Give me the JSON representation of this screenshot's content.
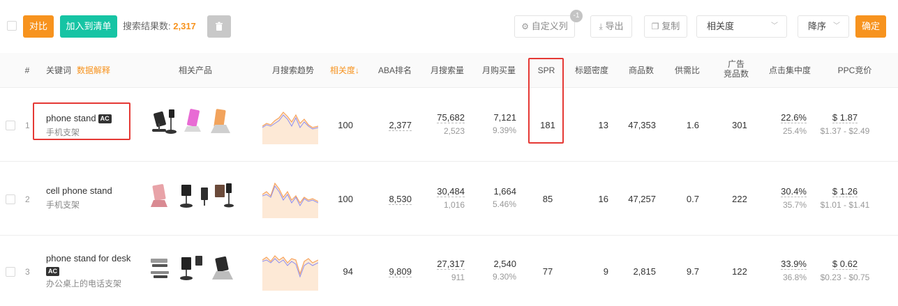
{
  "toolbar": {
    "compare_label": "对比",
    "add_to_list_label": "加入到清单",
    "result_label": "搜索结果数:",
    "result_count": "2,317",
    "customize_label": "自定义列",
    "customize_badge": "-1",
    "export_label": "导出",
    "copy_label": "复制",
    "sort_field": "相关度",
    "sort_order": "降序",
    "confirm_label": "确定"
  },
  "columns": {
    "index": "#",
    "keyword": "关键词",
    "keyword_help": "数据解释",
    "products": "相关产品",
    "trend": "月搜索趋势",
    "relevance": "相关度",
    "aba_rank": "ABA排名",
    "monthly_search": "月搜索量",
    "monthly_purchase": "月购买量",
    "spr": "SPR",
    "title_density": "标题密度",
    "product_count": "商品数",
    "supply_demand": "供需比",
    "ad_products_line1": "广告",
    "ad_products_line2": "竞品数",
    "click_concentration": "点击集中度",
    "ppc_bid": "PPC竞价"
  },
  "rows": [
    {
      "index": "1",
      "keyword": "phone stand",
      "ac": "AC",
      "keyword_cn": "手机支架",
      "relevance": "100",
      "aba_rank": "2,377",
      "monthly_search": "75,682",
      "monthly_search_sub": "2,523",
      "monthly_purchase": "7,121",
      "purchase_rate": "9.39%",
      "spr": "181",
      "title_density": "13",
      "product_count": "47,353",
      "supply_demand": "1.6",
      "ad_products": "301",
      "click_conc": "22.6%",
      "click_conc_sub": "25.4%",
      "ppc": "$ 1.87",
      "ppc_range": "$1.37 - $2.49"
    },
    {
      "index": "2",
      "keyword": "cell phone stand",
      "ac": "",
      "keyword_cn": "手机支架",
      "relevance": "100",
      "aba_rank": "8,530",
      "monthly_search": "30,484",
      "monthly_search_sub": "1,016",
      "monthly_purchase": "1,664",
      "purchase_rate": "5.46%",
      "spr": "85",
      "title_density": "16",
      "product_count": "47,257",
      "supply_demand": "0.7",
      "ad_products": "222",
      "click_conc": "30.4%",
      "click_conc_sub": "35.7%",
      "ppc": "$ 1.26",
      "ppc_range": "$1.01 - $1.41"
    },
    {
      "index": "3",
      "keyword": "phone stand for desk",
      "ac": "AC",
      "keyword_cn": "办公桌上的电话支架",
      "relevance": "94",
      "aba_rank": "9,809",
      "monthly_search": "27,317",
      "monthly_search_sub": "911",
      "monthly_purchase": "2,540",
      "purchase_rate": "9.30%",
      "spr": "77",
      "title_density": "9",
      "product_count": "2,815",
      "supply_demand": "9.7",
      "ad_products": "122",
      "click_conc": "33.9%",
      "click_conc_sub": "36.8%",
      "ppc": "$ 0.62",
      "ppc_range": "$0.23 - $0.75"
    }
  ],
  "colors": {
    "accent": "#f7931e",
    "teal": "#16c4a4",
    "highlight": "#e53935"
  },
  "icons": [
    "trash-icon",
    "gear-icon",
    "download-icon",
    "copy-icon",
    "chevron-down-icon",
    "sort-down-icon"
  ]
}
